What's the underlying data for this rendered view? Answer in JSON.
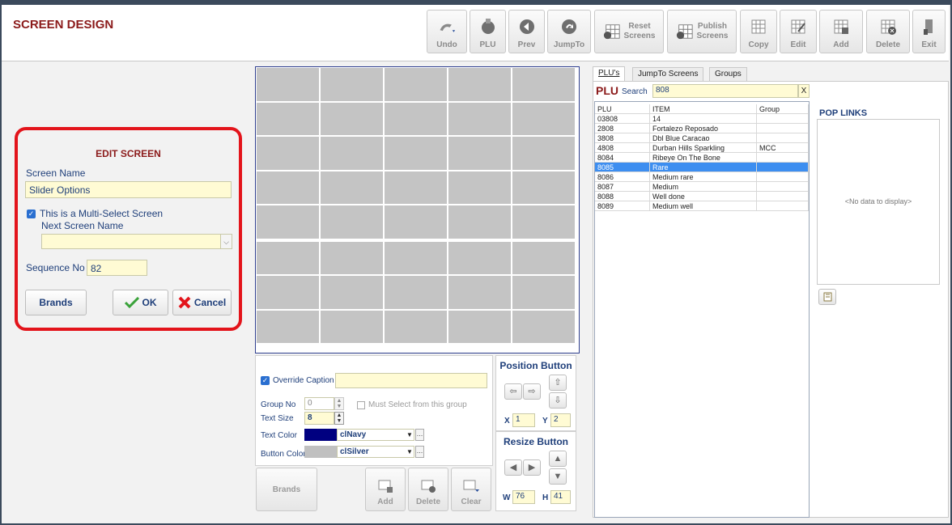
{
  "app": {
    "title": "SCREEN DESIGN"
  },
  "toolbar": {
    "undo": "Undo",
    "plu": "PLU",
    "prev": "Prev",
    "jumpto": "JumpTo",
    "reset_line1": "Reset",
    "reset_line2": "Screens",
    "publish_line1": "Publish",
    "publish_line2": "Screens",
    "copy": "Copy",
    "edit": "Edit",
    "add": "Add",
    "delete": "Delete",
    "exit": "Exit"
  },
  "edit_screen": {
    "title": "EDIT SCREEN",
    "screen_name_label": "Screen Name",
    "screen_name_value": "Slider Options",
    "multi_select_label": "This is a Multi-Select Screen",
    "next_screen_label": "Next Screen Name",
    "next_screen_value": "",
    "sequence_label": "Sequence No",
    "sequence_value": "82",
    "brands_button": "Brands",
    "ok_button": "OK",
    "cancel_button": "Cancel"
  },
  "button_props": {
    "override_caption_label": "Override Caption",
    "override_caption_value": "",
    "group_no_label": "Group No",
    "group_no_value": "0",
    "must_select_label": "Must Select from this group",
    "text_size_label": "Text Size",
    "text_size_value": "8",
    "text_color_label": "Text Color",
    "text_color_name": "clNavy",
    "text_color_hex": "#000080",
    "button_color_label": "Button Color",
    "button_color_name": "clSilver",
    "button_color_hex": "#c0c0c0"
  },
  "position": {
    "title": "Position Button",
    "x_label": "X",
    "x_value": "1",
    "y_label": "Y",
    "y_value": "2"
  },
  "resize": {
    "title": "Resize Button",
    "w_label": "W",
    "w_value": "76",
    "h_label": "H",
    "h_value": "41"
  },
  "bottom_buttons": {
    "brands": "Brands",
    "add": "Add",
    "delete": "Delete",
    "clear": "Clear"
  },
  "tabs": [
    "PLU's",
    "JumpTo Screens",
    "Groups"
  ],
  "plu": {
    "title": "PLU",
    "search_label": "Search",
    "search_value": "808",
    "clear_label": "X",
    "columns": [
      "PLU",
      "ITEM",
      "Group"
    ],
    "rows": [
      [
        "03808",
        "14",
        ""
      ],
      [
        "2808",
        "Fortalezo Reposado",
        ""
      ],
      [
        "3808",
        "Dbl Blue Caracao",
        ""
      ],
      [
        "4808",
        "Durban Hills Sparkling",
        "MCC"
      ],
      [
        "8084",
        "Ribeye On The Bone",
        ""
      ],
      [
        "8085",
        "Rare",
        ""
      ],
      [
        "8086",
        "Medium rare",
        ""
      ],
      [
        "8087",
        "Medium",
        ""
      ],
      [
        "8088",
        "Well done",
        ""
      ],
      [
        "8089",
        "Medium well",
        ""
      ]
    ],
    "selected_index": 5
  },
  "pop_links": {
    "title": "POP LINKS",
    "empty_text": "<No data to display>"
  }
}
